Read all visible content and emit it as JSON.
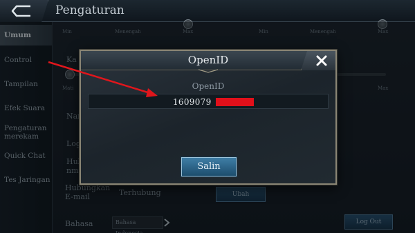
{
  "header": {
    "title": "Pengaturan"
  },
  "sidebar": {
    "items": [
      {
        "label": "Umum",
        "active": true
      },
      {
        "label": "Control"
      },
      {
        "label": "Tampilan"
      },
      {
        "label": "Efek Suara"
      },
      {
        "label": "Pengaturan merekam"
      },
      {
        "label": "Quick Chat"
      },
      {
        "label": "Tes Jaringan"
      }
    ]
  },
  "background": {
    "slider_labels_1": [
      "Min",
      "Menengah",
      "Max"
    ],
    "slider_labels_2": [
      "Min",
      "Menengah",
      "Max"
    ],
    "ka_label": "Ka",
    "mati_label": "Mati",
    "max_label": "Max",
    "nam_label": "Nam",
    "log_label": "Log",
    "hubung_label": "Hubu nmm",
    "hubungkan_email_label": "Hubungkan E-mail",
    "terhubung": "Terhubung",
    "ubah_button": "Ubah",
    "bahasa_label": "Bahasa",
    "bahasa_value": "Bahasa Indonesia",
    "logout_button": "Log Out"
  },
  "modal": {
    "title": "OpenID",
    "field_label": "OpenID",
    "openid_value": "1609079",
    "copy_button": "Salin"
  },
  "colors": {
    "accent_button": "#2f6b92",
    "redaction": "#e1101a",
    "arrow": "#e0161c"
  }
}
